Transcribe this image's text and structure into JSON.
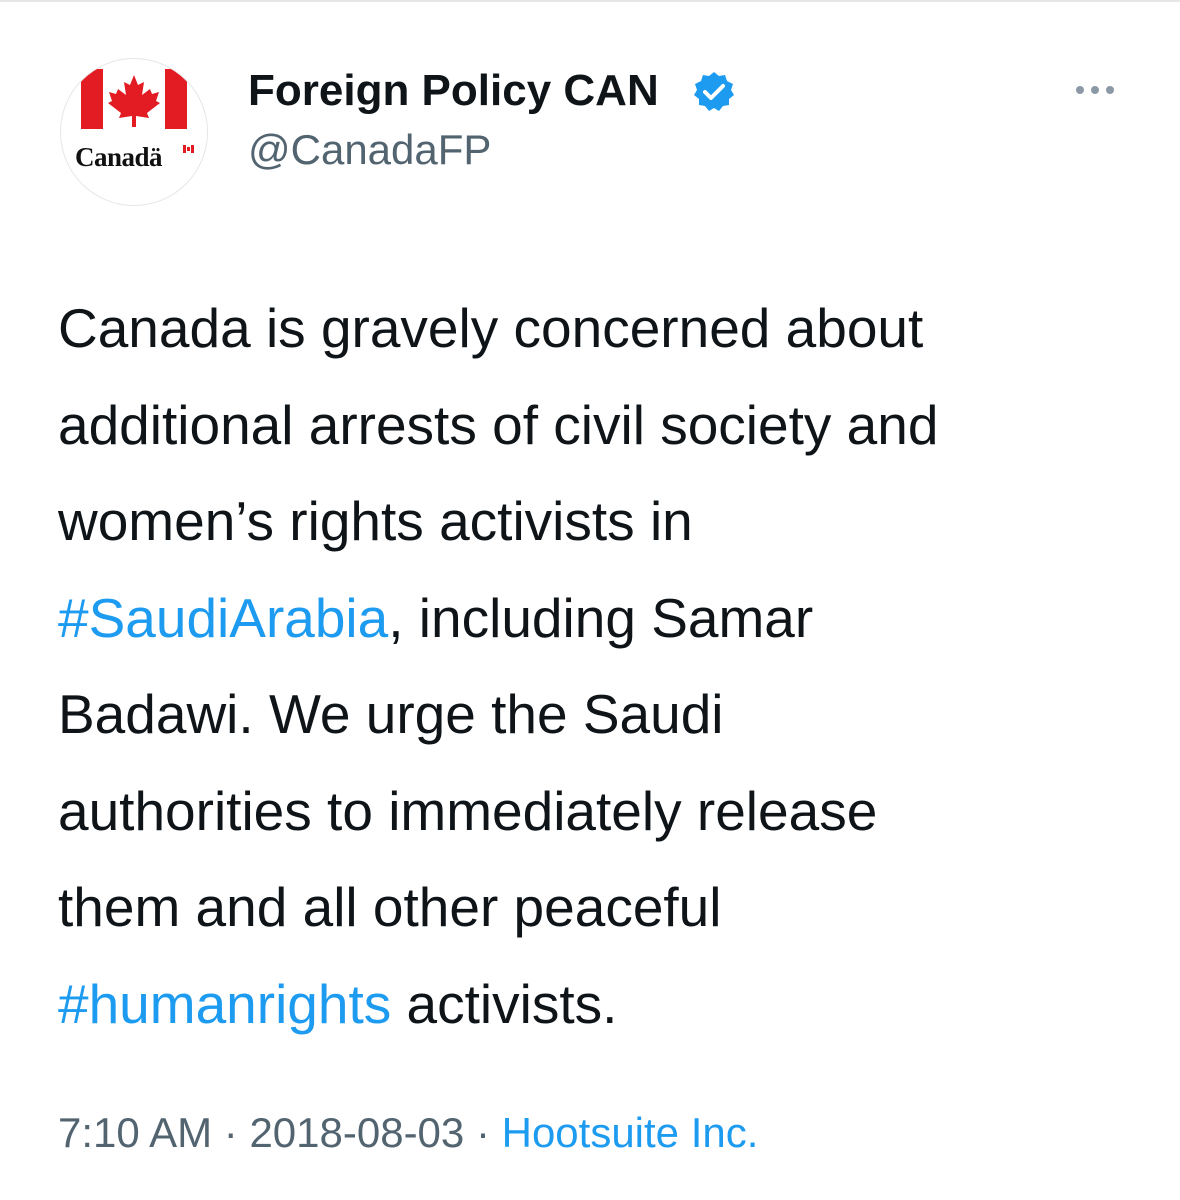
{
  "tweet": {
    "author": {
      "display_name": "Foreign Policy CAN",
      "handle": "@CanadaFP",
      "verified": true,
      "avatar": {
        "icon": "canada-flag-logo",
        "wordmark": "Canadä"
      }
    },
    "more_icon": "more-horizontal-icon",
    "text_lines": {
      "l1": "Canada is gravely concerned about",
      "l2": "additional arrests of civil society and",
      "l3": "women’s rights activists in",
      "l4_hashtag": "#SaudiArabia",
      "l4_rest": ", including Samar",
      "l5": "Badawi. We urge the Saudi",
      "l6": "authorities to immediately release",
      "l7": "them and all other peaceful",
      "l8_hashtag": "#humanrights",
      "l8_rest": " activists."
    },
    "meta": {
      "time": "7:10 AM",
      "separator": " · ",
      "date": "2018-08-03",
      "source": "Hootsuite Inc."
    }
  },
  "colors": {
    "link_blue": "#1d9bf0",
    "canada_red": "#e31b23",
    "secondary_text": "#536471"
  }
}
